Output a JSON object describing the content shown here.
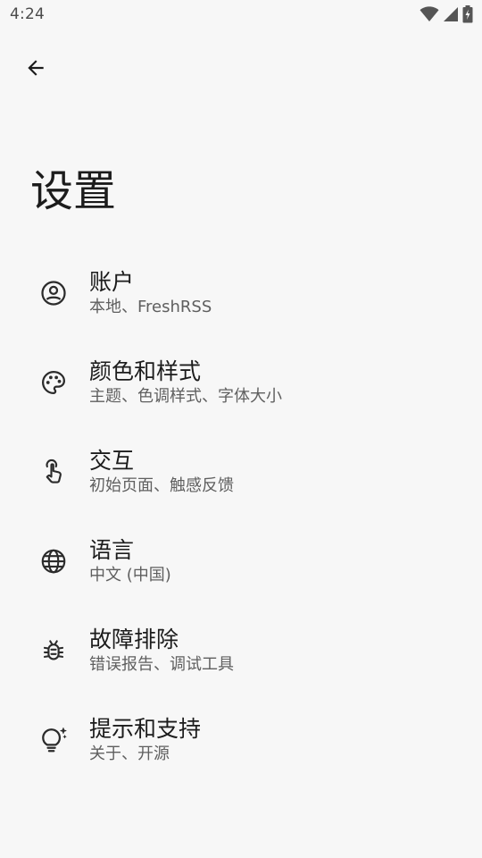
{
  "status_bar": {
    "time": "4:24",
    "icons": [
      "wifi-icon",
      "cell-signal-icon",
      "battery-charging-icon"
    ]
  },
  "header": {
    "back_icon": "arrow-back-icon",
    "title": "设置"
  },
  "settings": {
    "items": [
      {
        "icon": "account-circle-icon",
        "title": "账户",
        "subtitle": "本地、FreshRSS"
      },
      {
        "icon": "palette-icon",
        "title": "颜色和样式",
        "subtitle": "主题、色调样式、字体大小"
      },
      {
        "icon": "touch-app-icon",
        "title": "交互",
        "subtitle": "初始页面、触感反馈"
      },
      {
        "icon": "language-globe-icon",
        "title": "语言",
        "subtitle": "中文 (中国)"
      },
      {
        "icon": "bug-report-icon",
        "title": "故障排除",
        "subtitle": "错误报告、调试工具"
      },
      {
        "icon": "tips-lightbulb-icon",
        "title": "提示和支持",
        "subtitle": "关于、开源"
      }
    ]
  },
  "colors": {
    "background": "#f7f7f7",
    "text_primary": "#1c1c1c",
    "text_secondary": "#5f5f5f",
    "icon": "#2b2b2b"
  }
}
